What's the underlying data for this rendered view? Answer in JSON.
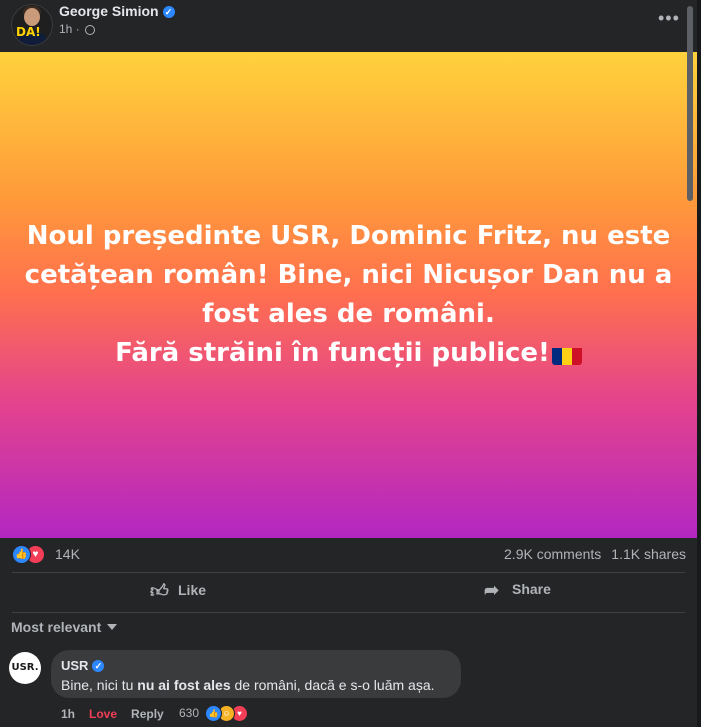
{
  "post": {
    "author": "George Simion",
    "verified_mark": "✓",
    "time": "1h",
    "time_separator": "·",
    "more_label": "•••",
    "avatar_text": "DA!",
    "banner_lines": [
      "Noul președinte USR, Dominic Fritz, nu este",
      "cetățean român! Bine, nici Nicușor Dan nu a",
      "fost ales de români.",
      "Fără străini în funcții publice!"
    ],
    "flag_colors": [
      "#002b7f",
      "#fcd116",
      "#ce1126"
    ],
    "reactions": {
      "icons": [
        "like-icon",
        "love-icon"
      ],
      "count": "14K"
    },
    "comments_count": "2.9K comments",
    "shares_count": "1.1K shares",
    "actions": {
      "like": "Like",
      "share": "Share"
    }
  },
  "comments_section": {
    "sort_label": "Most relevant",
    "comment": {
      "avatar_text": "USR.",
      "author": "USR",
      "verified_mark": "✓",
      "text_before": "Bine, nici tu ",
      "text_bold": "nu ai fost ales",
      "text_after": " de români, dacă e s-o luăm așa.",
      "time": "1h",
      "love_label": "Love",
      "reply_label": "Reply",
      "reaction_count": "630",
      "reaction_icons": [
        "like-icon",
        "laugh-icon",
        "love-icon"
      ]
    }
  },
  "colors": {
    "background": "#242526",
    "accent_blue": "#2d88ff",
    "love_red": "#f33e58"
  }
}
